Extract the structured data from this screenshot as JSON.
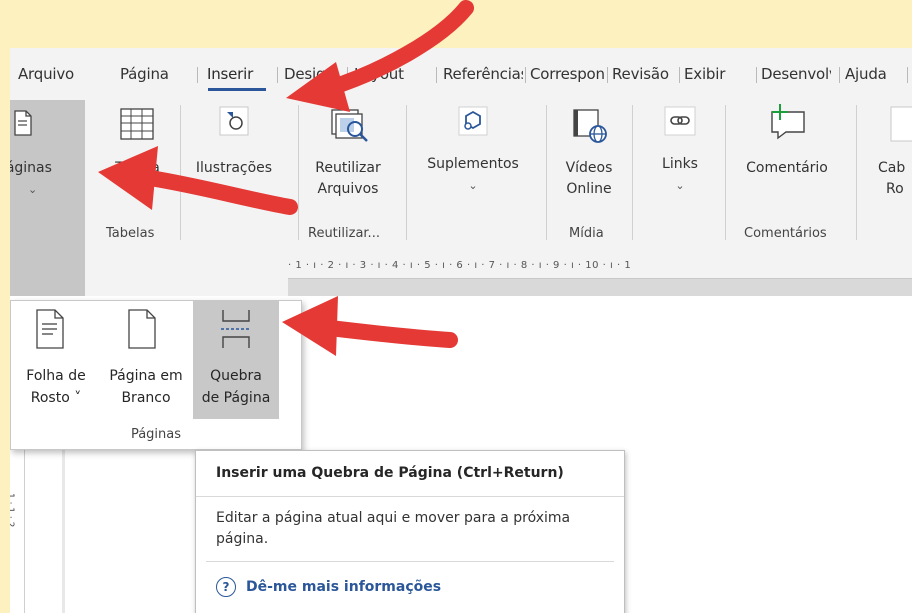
{
  "tabs": [
    {
      "label": "Arquivo"
    },
    {
      "label": "Página"
    },
    {
      "label": "Inserir"
    },
    {
      "label": "Design"
    },
    {
      "label": "Layout"
    },
    {
      "label": "Referências"
    },
    {
      "label": "Correspondências"
    },
    {
      "label": "Revisão"
    },
    {
      "label": "Exibir"
    },
    {
      "label": "Desenvolvedor"
    },
    {
      "label": "Ajuda"
    }
  ],
  "ribbon": {
    "paginas": "Páginas",
    "tabela": "Tabela",
    "ilustracoes": "Ilustrações",
    "reutilizar_1": "Reutilizar",
    "reutilizar_2": "Arquivos",
    "suplementos": "Suplementos",
    "videos_1": "Vídeos",
    "videos_2": "Online",
    "links": "Links",
    "comentario": "Comentário",
    "cab_1": "Cab",
    "cab_2": "Ro",
    "chevron": "⌄",
    "groups": {
      "tabelas": "Tabelas",
      "reutilizar": "Reutilizar...",
      "midia": "Mídia",
      "comentarios": "Comentários"
    }
  },
  "ruler_text": "· 1 · ı · 2 · ı · 3 · ı · 4 · ı · 5 · ı · 6 · ı · 7 · ı · 8 · ı · 9 · ı · 10 · ı · 1",
  "vruler_text": "1 · 1 · 2",
  "dropdown": {
    "items": [
      {
        "line1": "Folha de",
        "line2": "Rosto ˅"
      },
      {
        "line1": "Página em",
        "line2": "Branco"
      },
      {
        "line1": "Quebra",
        "line2": "de Página"
      }
    ],
    "group_label": "Páginas"
  },
  "tooltip": {
    "title": "Inserir uma Quebra de Página (Ctrl+Return)",
    "description": "Editar a página atual aqui e mover para a próxima página.",
    "help_icon": "?",
    "link": "Dê-me mais informações"
  },
  "colors": {
    "background": "#fdf1c0",
    "accent": "#2b579a",
    "arrow": "#e53935"
  }
}
